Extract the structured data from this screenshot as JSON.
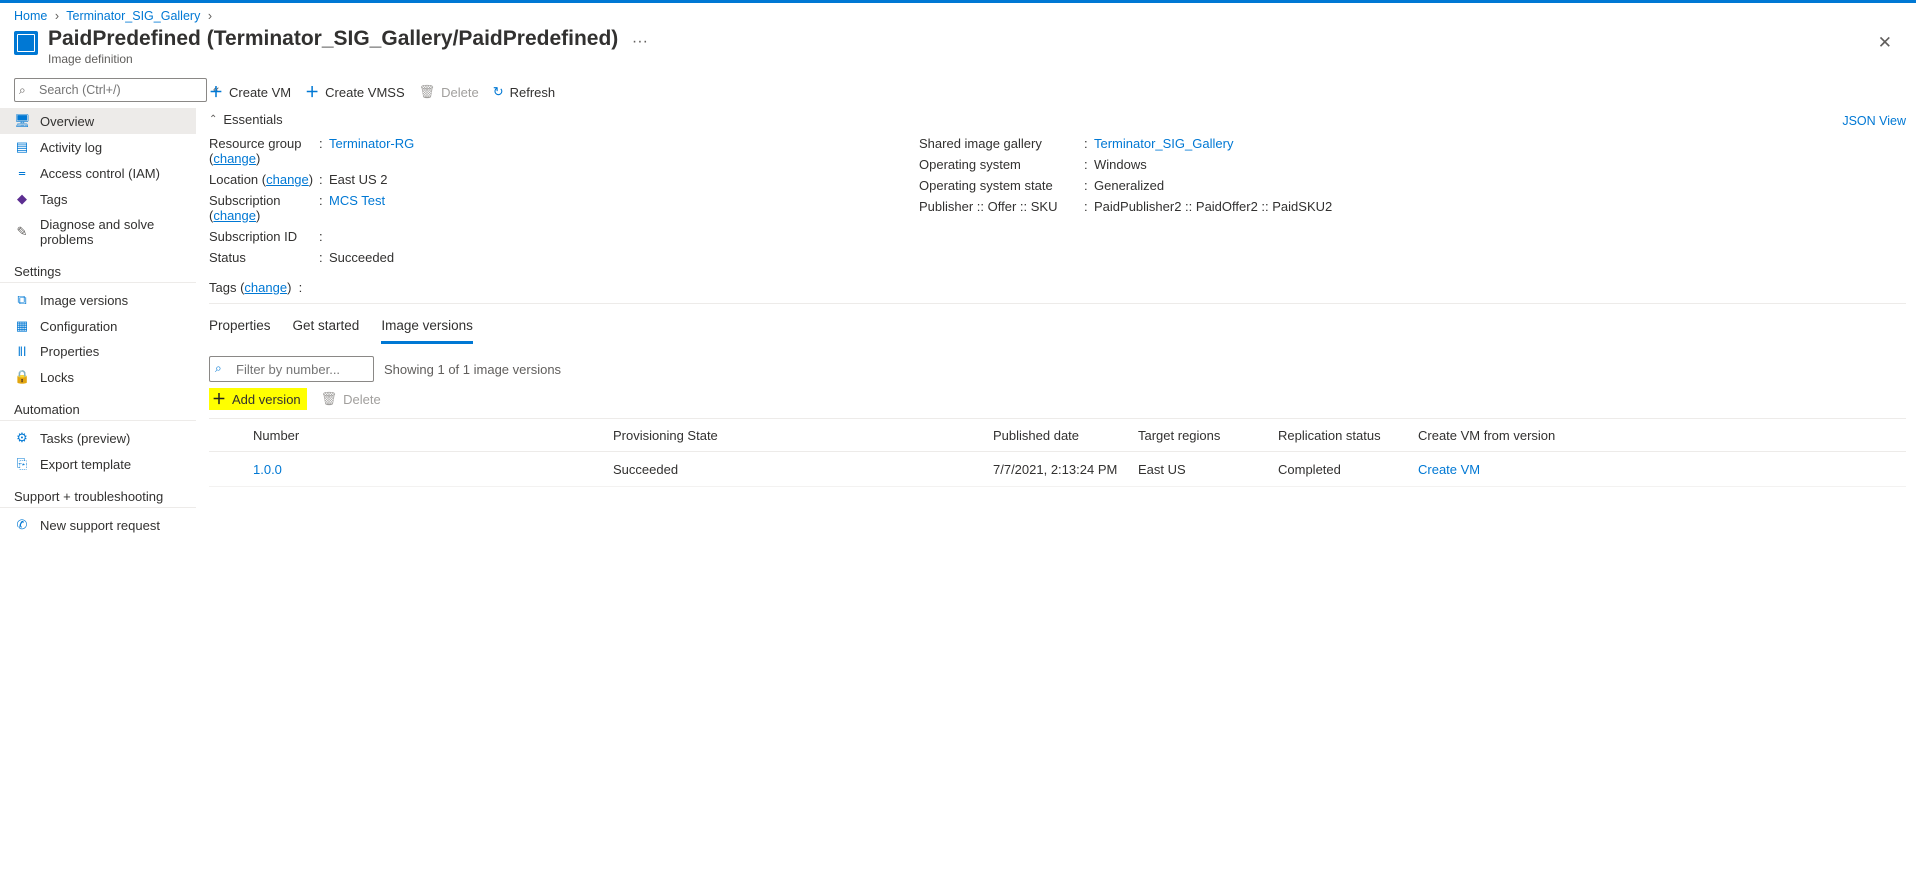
{
  "breadcrumb": {
    "home": "Home",
    "gallery": "Terminator_SIG_Gallery"
  },
  "header": {
    "title": "PaidPredefined (Terminator_SIG_Gallery/PaidPredefined)",
    "subtitle": "Image definition",
    "more": "···"
  },
  "sidebar": {
    "search_placeholder": "Search (Ctrl+/)",
    "items_top": [
      {
        "icon": "🖥",
        "c": "c-blue",
        "label": "Overview",
        "active": true
      },
      {
        "icon": "▤",
        "c": "c-blue",
        "label": "Activity log"
      },
      {
        "icon": "᐀",
        "c": "c-blue",
        "label": "Access control (IAM)"
      },
      {
        "icon": "◆",
        "c": "c-purple",
        "label": "Tags"
      },
      {
        "icon": "✎",
        "c": "c-grey",
        "label": "Diagnose and solve problems"
      }
    ],
    "groups": [
      {
        "title": "Settings",
        "items": [
          {
            "icon": "⧉",
            "c": "c-blue",
            "label": "Image versions"
          },
          {
            "icon": "▦",
            "c": "c-blue",
            "label": "Configuration"
          },
          {
            "icon": "ǁǀ",
            "c": "c-blue",
            "label": "Properties"
          },
          {
            "icon": "🔒",
            "c": "c-blue",
            "label": "Locks"
          }
        ]
      },
      {
        "title": "Automation",
        "items": [
          {
            "icon": "⚙",
            "c": "c-blue",
            "label": "Tasks (preview)"
          },
          {
            "icon": "⎘",
            "c": "c-blue",
            "label": "Export template"
          }
        ]
      },
      {
        "title": "Support + troubleshooting",
        "items": [
          {
            "icon": "✆",
            "c": "c-blue",
            "label": "New support request"
          }
        ]
      }
    ]
  },
  "toolbar": {
    "create_vm": "Create VM",
    "create_vmss": "Create VMSS",
    "delete": "Delete",
    "refresh": "Refresh"
  },
  "essentials": {
    "header": "Essentials",
    "json_view": "JSON View",
    "left": {
      "resource_group_label": "Resource group",
      "resource_group_change": "change",
      "resource_group_value": "Terminator-RG",
      "location_label": "Location",
      "location_change": "change",
      "location_value": "East US 2",
      "subscription_label": "Subscription",
      "subscription_change": "change",
      "subscription_value": "MCS Test",
      "subscription_id_label": "Subscription ID",
      "subscription_id_value": "",
      "status_label": "Status",
      "status_value": "Succeeded"
    },
    "right": {
      "sig_label": "Shared image gallery",
      "sig_value": "Terminator_SIG_Gallery",
      "os_label": "Operating system",
      "os_value": "Windows",
      "os_state_label": "Operating system state",
      "os_state_value": "Generalized",
      "pos_label": "Publisher :: Offer :: SKU",
      "pos_value": "PaidPublisher2 :: PaidOffer2 :: PaidSKU2"
    },
    "tags_label": "Tags",
    "tags_change": "change"
  },
  "tabs": {
    "properties": "Properties",
    "get_started": "Get started",
    "image_versions": "Image versions"
  },
  "filter": {
    "placeholder": "Filter by number...",
    "count_text": "Showing 1 of 1 image versions",
    "add_version": "Add version",
    "delete": "Delete"
  },
  "table": {
    "headers": {
      "number": "Number",
      "provisioning": "Provisioning State",
      "published": "Published date",
      "targets": "Target regions",
      "replication": "Replication status",
      "create": "Create VM from version"
    },
    "rows": [
      {
        "number": "1.0.0",
        "provisioning": "Succeeded",
        "published": "7/7/2021, 2:13:24 PM",
        "targets": "East US",
        "replication": "Completed",
        "create": "Create VM"
      }
    ]
  }
}
